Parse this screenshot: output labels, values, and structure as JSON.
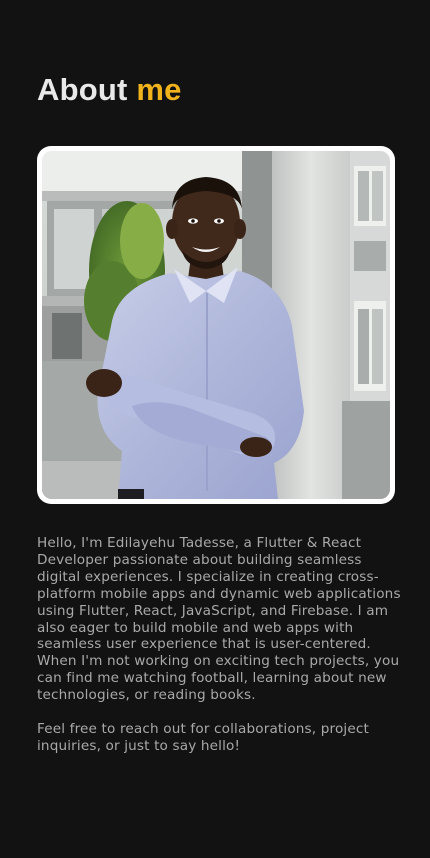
{
  "about": {
    "title_lead": "About",
    "title_accent": "me",
    "bio_paragraphs": [
      "Hello, I'm Edilayehu Tadesse, a Flutter & React Developer passionate about building seamless digital experiences. I specialize in creating cross-platform mobile apps and dynamic web applications using Flutter, React, JavaScript, and Firebase. I am also eager to build mobile and web apps with seamless user experience that is user-centered. When I'm not working on exciting tech projects, you can find me watching football, learning about new technologies, or reading books.",
      "Feel free to reach out for collaborations, project inquiries, or just to say hello!"
    ]
  },
  "colors": {
    "background": "#121212",
    "title": "#e9e9e9",
    "accent": "#f0b31b",
    "body_text": "#a9a9a9",
    "frame": "#ffffff"
  }
}
